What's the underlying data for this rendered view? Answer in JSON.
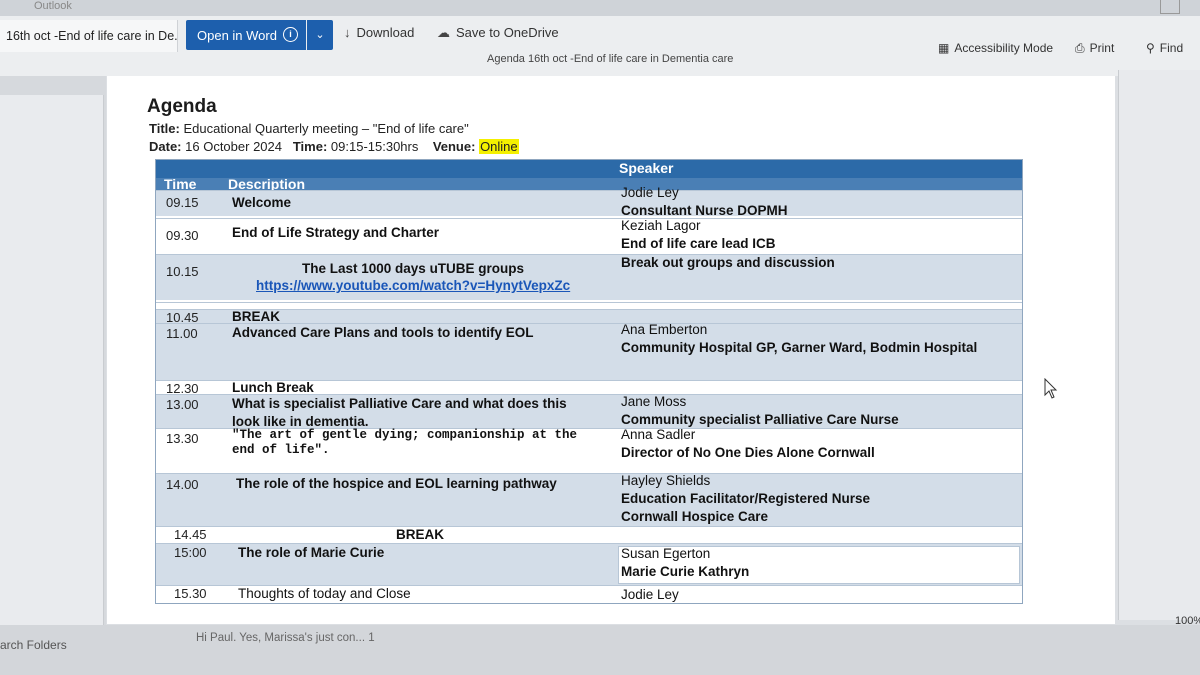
{
  "app": {
    "title": "Outlook"
  },
  "toolbar": {
    "tab_title": "16th oct -End of life care in De...",
    "open_in_word": "Open in Word",
    "info_icon": "i",
    "dropdown_icon": "chevron-down-icon",
    "download": "Download",
    "download_icon": "↓",
    "save_onedrive": "Save to OneDrive",
    "onedrive_icon": "☁"
  },
  "viewer": {
    "document_title": "Agenda 16th oct -End of life care in Dementia care",
    "accessibility_mode": "Accessibility Mode",
    "print": "Print",
    "find": "Find",
    "zoom": "100%"
  },
  "document": {
    "heading": "Agenda",
    "title_label": "Title:",
    "title_value": "Educational Quarterly meeting – \"End of life care\"",
    "date_label": "Date:",
    "date_value": "16 October 2024",
    "time_label": "Time:",
    "time_value": "09:15-15:30hrs",
    "venue_label": "Venue:",
    "venue_value": "Online",
    "table": {
      "headers": {
        "time": "Time",
        "description": "Description",
        "speaker": "Speaker"
      },
      "rows": [
        {
          "time": "09.15",
          "description": "Welcome",
          "speaker_name": "Jodie Ley",
          "speaker_role": "Consultant Nurse DOPMH"
        },
        {
          "time": "09.30",
          "description": "End of Life Strategy and Charter",
          "speaker_name": "Keziah Lagor",
          "speaker_role": "End of life care lead ICB"
        },
        {
          "time": "10.15",
          "description": "The Last 1000 days uTUBE groups",
          "link": "https://www.youtube.com/watch?v=HynytVepxZc",
          "speaker_name": "",
          "speaker_role": "Break out groups and discussion"
        },
        {
          "time": "10.45",
          "description": "BREAK",
          "speaker_name": "",
          "speaker_role": ""
        },
        {
          "time": "11.00",
          "description": "Advanced Care Plans and tools to identify EOL",
          "speaker_name": "Ana Emberton",
          "speaker_role": "Community Hospital GP, Garner Ward, Bodmin Hospital"
        },
        {
          "time": "12.30",
          "description": "Lunch Break",
          "speaker_name": "",
          "speaker_role": ""
        },
        {
          "time": "13.00",
          "description": "What is specialist Palliative Care and what does this look like in dementia.",
          "speaker_name": "Jane Moss",
          "speaker_role": "Community specialist Palliative Care Nurse"
        },
        {
          "time": "13.30",
          "description": "\"The art of gentle dying; companionship at the end of life\".",
          "speaker_name": "Anna Sadler",
          "speaker_role": "Director of No One Dies Alone Cornwall"
        },
        {
          "time": "14.00",
          "description": "The role of the hospice and EOL learning pathway",
          "speaker_name": "Hayley Shields",
          "speaker_role": "Education Facilitator/Registered Nurse Cornwall Hospice Care"
        },
        {
          "time": "14.45",
          "description": "BREAK",
          "speaker_name": "",
          "speaker_role": ""
        },
        {
          "time": "15:00",
          "description": "The role of Marie Curie",
          "speaker_name": "Susan Egerton",
          "speaker_role": "Marie Curie Kathryn"
        },
        {
          "time": "15.30",
          "description": "Thoughts of today and Close",
          "speaker_name": "Jodie Ley",
          "speaker_role": ""
        }
      ]
    }
  },
  "statusbar": {
    "folders": "arch Folders",
    "preview": "Hi Paul. Yes, Marissa's just con...",
    "preview_count": "1"
  },
  "colors": {
    "word_button": "#1d5fad",
    "table_header": "#2c6aa8",
    "row_shade": "#d3dde8",
    "highlight": "#f4f000",
    "link": "#1a56b8"
  }
}
